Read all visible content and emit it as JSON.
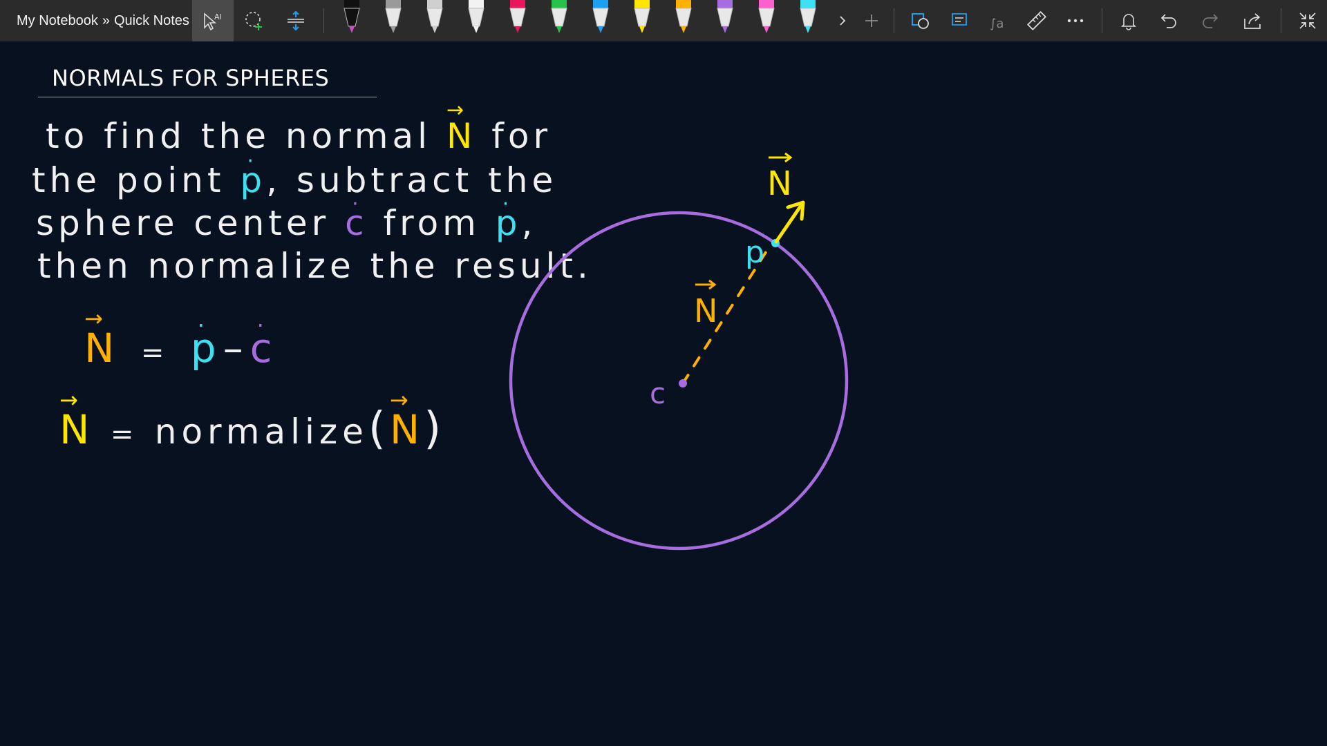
{
  "breadcrumb": {
    "notebook": "My Notebook",
    "separator": "»",
    "section": "Quick Notes"
  },
  "toolbar": {
    "tools": [
      "select-ink-icon",
      "lasso-select-icon",
      "add-space-icon"
    ],
    "pens": [
      {
        "name": "pen-black-purple",
        "color": "#111111",
        "accent": "#c850c0"
      },
      {
        "name": "pencil-gray",
        "color": "#9a9a9a"
      },
      {
        "name": "pen-light-gray",
        "color": "#cfcfcf"
      },
      {
        "name": "pen-white",
        "color": "#f2f2f2"
      },
      {
        "name": "pen-red",
        "color": "#e8175d"
      },
      {
        "name": "pen-green",
        "color": "#27c24c"
      },
      {
        "name": "pen-blue",
        "color": "#1ea0f2"
      },
      {
        "name": "pen-yellow",
        "color": "#ffe600"
      },
      {
        "name": "pen-orange",
        "color": "#ffb000"
      },
      {
        "name": "pen-purple",
        "color": "#a76de0"
      },
      {
        "name": "pen-pink",
        "color": "#ff5ecf"
      },
      {
        "name": "pen-cyan",
        "color": "#3ce0f0"
      }
    ],
    "right_tools": [
      "ink-to-shape-icon",
      "ink-to-text-icon",
      "ink-to-math-icon",
      "ruler-icon",
      "more-icon",
      "notification-bell-icon",
      "undo-icon",
      "redo-icon",
      "share-icon",
      "exit-fullscreen-icon"
    ]
  },
  "page": {
    "title": "NORMALS FOR SPHERES",
    "ink_lines": [
      {
        "pre": "to find the normal ",
        "sym": "N",
        "post": " for"
      },
      {
        "pre": "the point ",
        "sym": "p",
        "post": ", subtract the"
      },
      {
        "pre": "sphere center ",
        "sym": "c",
        "mid": " from ",
        "sym2": "p",
        "post": ","
      },
      {
        "pre": "then normalize the result.",
        "sym": "",
        "post": ""
      }
    ],
    "equation1": {
      "lhs": "N",
      "eq": "=",
      "a": "p",
      "minus": "–",
      "b": "c"
    },
    "equation2": {
      "lhs": "N",
      "eq": "=",
      "func": "normalize",
      "open": "(",
      "arg": "N",
      "close": ")"
    }
  },
  "diagram": {
    "center_label": "c",
    "point_label": "p",
    "inner_vector_label": "N",
    "outer_vector_label": "N"
  },
  "colors": {
    "yellow": "#ffe600",
    "orange": "#ffb000",
    "cyan": "#3ce0f0",
    "purple": "#a76de0",
    "white_ink": "#f0f0f0",
    "toolbar_bg": "#2b2b2b",
    "canvas_bg": "#08111f"
  }
}
